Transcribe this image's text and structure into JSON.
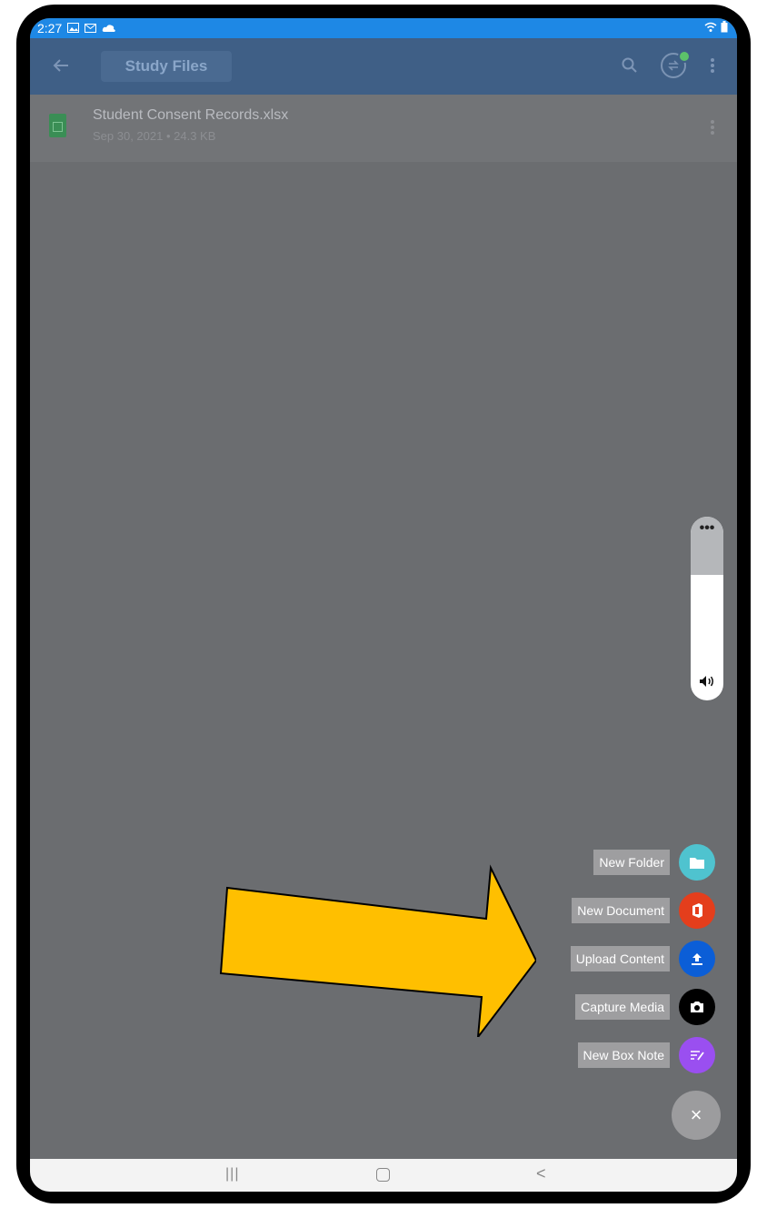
{
  "status_bar": {
    "time": "2:27"
  },
  "app_bar": {
    "title": "Study Files"
  },
  "file": {
    "name": "Student Consent Records.xlsx",
    "meta": "Sep 30, 2021  •  24.3 KB"
  },
  "volume_panel": {
    "more": "•••"
  },
  "fab_menu": {
    "items": [
      {
        "label": "New Folder",
        "color": "#4fc3cf"
      },
      {
        "label": "New Document",
        "color": "#e43e1c"
      },
      {
        "label": "Upload Content",
        "color": "#0b5ed7"
      },
      {
        "label": "Capture Media",
        "color": "#000000"
      },
      {
        "label": "New Box Note",
        "color": "#9a4ff0"
      }
    ],
    "close_label": "×"
  },
  "annotation": {
    "arrow_color": "#ffbf00"
  }
}
